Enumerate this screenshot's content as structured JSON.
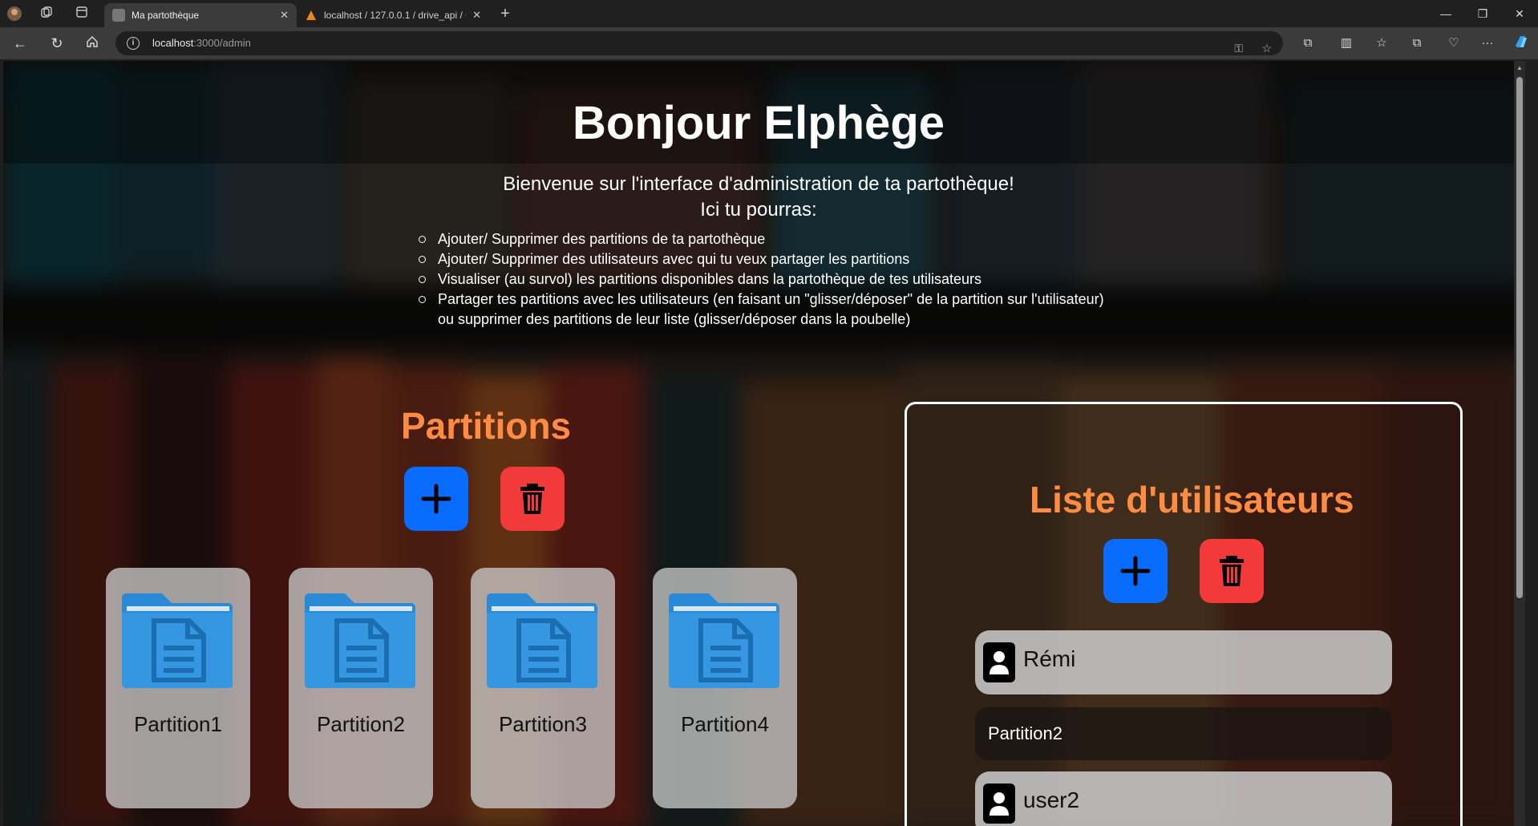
{
  "browser": {
    "tabs": [
      {
        "title": "Ma partothèque",
        "active": true
      },
      {
        "title": "localhost / 127.0.0.1 / drive_api / u",
        "active": false
      }
    ],
    "address": {
      "host": "localhost",
      "path": ":3000/admin"
    }
  },
  "page": {
    "greeting": "Bonjour Elphège",
    "welcome_line1": "Bienvenue sur l'interface d'administration de ta partothèque!",
    "welcome_line2": "Ici tu pourras:",
    "features": [
      "Ajouter/ Supprimer des partitions de ta partothèque",
      "Ajouter/ Supprimer des utilisateurs avec qui tu veux partager les partitions",
      "Visualiser (au survol) les partitions disponibles dans la partothèque de tes utilisateurs",
      "Partager tes partitions avec les utilisateurs (en faisant un \"glisser/déposer\" de la partition sur l'utilisateur)",
      "ou supprimer des partitions de leur liste (glisser/déposer dans la poubelle)"
    ],
    "partitions": {
      "title": "Partitions",
      "items": [
        "Partition1",
        "Partition2",
        "Partition3",
        "Partition4"
      ]
    },
    "users": {
      "title": "Liste d'utilisateurs",
      "items": [
        {
          "name": "Rémi",
          "shared": [
            "Partition2"
          ]
        },
        {
          "name": "user2",
          "shared": []
        }
      ]
    }
  },
  "colors": {
    "accent_orange": "#ff8c42",
    "add_blue": "#0a6cff",
    "delete_red": "#f23a3a",
    "folder_blue": "#2a8ad6"
  },
  "icons": {
    "add": "plus-icon",
    "delete": "trash-icon",
    "partition": "folder-document-icon",
    "user": "user-icon"
  }
}
